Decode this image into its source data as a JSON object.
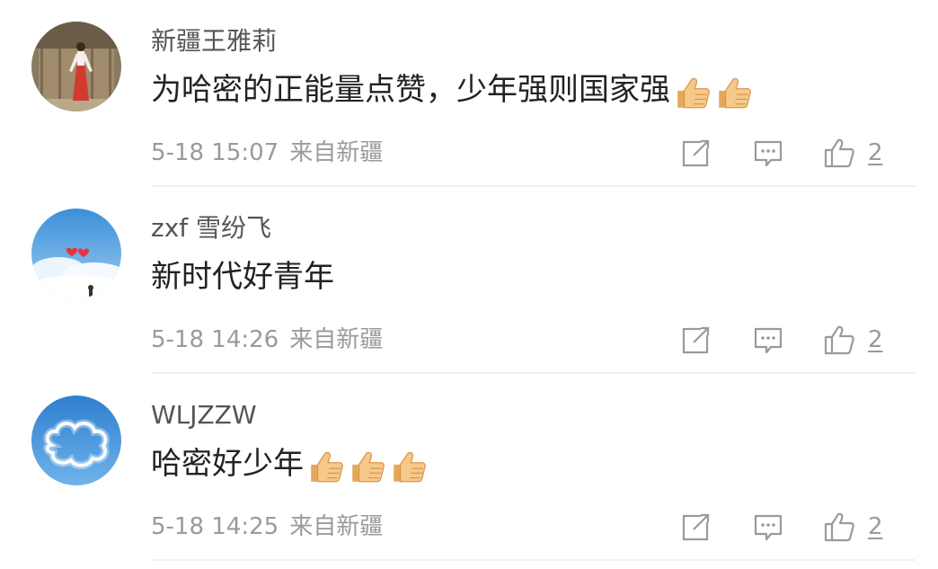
{
  "comments": [
    {
      "username": "新疆王雅莉",
      "text": "为哈密的正能量点赞，少年强则国家强",
      "emoji_count": 2,
      "emoji_icon": "thumbs-up-emoji",
      "time": "5-18 15:07",
      "source": "来自新疆",
      "likes": "2"
    },
    {
      "username": "zxf 雪纷飞",
      "text": "新时代好青年",
      "emoji_count": 0,
      "emoji_icon": "",
      "time": "5-18 14:26",
      "source": "来自新疆",
      "likes": "2"
    },
    {
      "username": "WLJZZW",
      "text": "哈密好少年",
      "emoji_count": 3,
      "emoji_icon": "thumbs-up-emoji",
      "time": "5-18 14:25",
      "source": "来自新疆",
      "likes": "2"
    }
  ],
  "icons": {
    "share": "share-icon",
    "reply": "comment-icon",
    "like": "thumbs-up-icon"
  },
  "colors": {
    "username": "#555555",
    "content": "#222222",
    "meta": "#9a9a9a",
    "icon": "#9a9a9a",
    "emoji": "#f2c27c"
  }
}
